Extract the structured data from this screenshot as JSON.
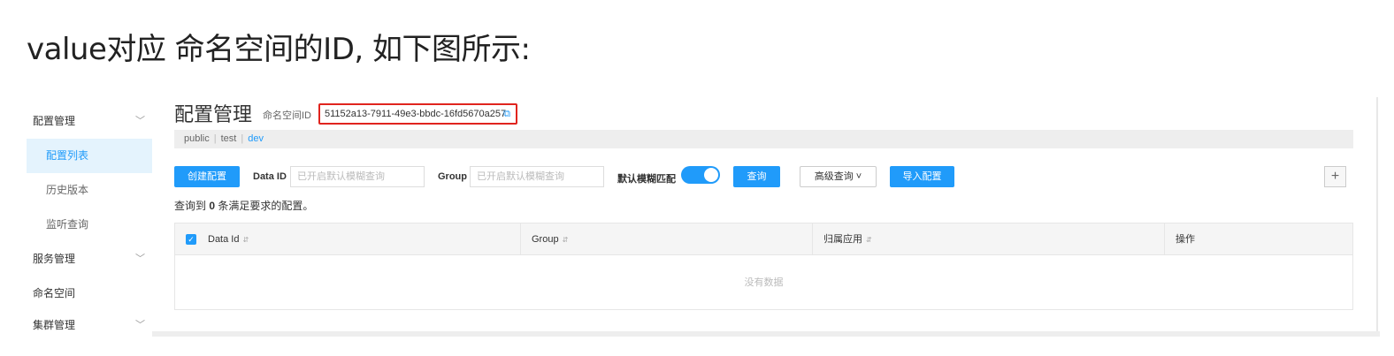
{
  "heading": "value对应 命名空间的ID, 如下图所示:",
  "sidebar": {
    "items": [
      {
        "label": "配置管理",
        "chevron": "﹀"
      },
      {
        "label": "配置列表"
      },
      {
        "label": "历史版本"
      },
      {
        "label": "监听查询"
      },
      {
        "label": "服务管理",
        "chevron": "﹀"
      },
      {
        "label": "命名空间"
      },
      {
        "label": "集群管理",
        "chevron": "﹀"
      }
    ]
  },
  "main": {
    "title": "配置管理",
    "namespace_label": "命名空间ID",
    "namespace_id": "51152a13-7911-49e3-bbdc-16fd5670a257",
    "tabs": [
      "public",
      "test",
      "dev"
    ],
    "tab_separator": "|",
    "toolbar": {
      "create_label": "创建配置",
      "dataid_label": "Data ID",
      "dataid_placeholder": "已开启默认模糊查询",
      "group_label": "Group",
      "group_placeholder": "已开启默认模糊查询",
      "fuzzy_label": "默认模糊匹配",
      "fuzzy_enabled": true,
      "query_label": "查询",
      "advanced_label": "高级查询 ˅",
      "import_label": "导入配置",
      "plus_label": "+"
    },
    "result": {
      "prefix": "查询到",
      "count": "0",
      "suffix": "条满足要求的配置。"
    },
    "table": {
      "columns": [
        "Data Id",
        "Group",
        "归属应用",
        "操作"
      ],
      "sort_glyph": "⇵",
      "empty_text": "没有数据"
    }
  },
  "colors": {
    "accent": "#209bfa",
    "highlight_border": "#e0241e"
  }
}
